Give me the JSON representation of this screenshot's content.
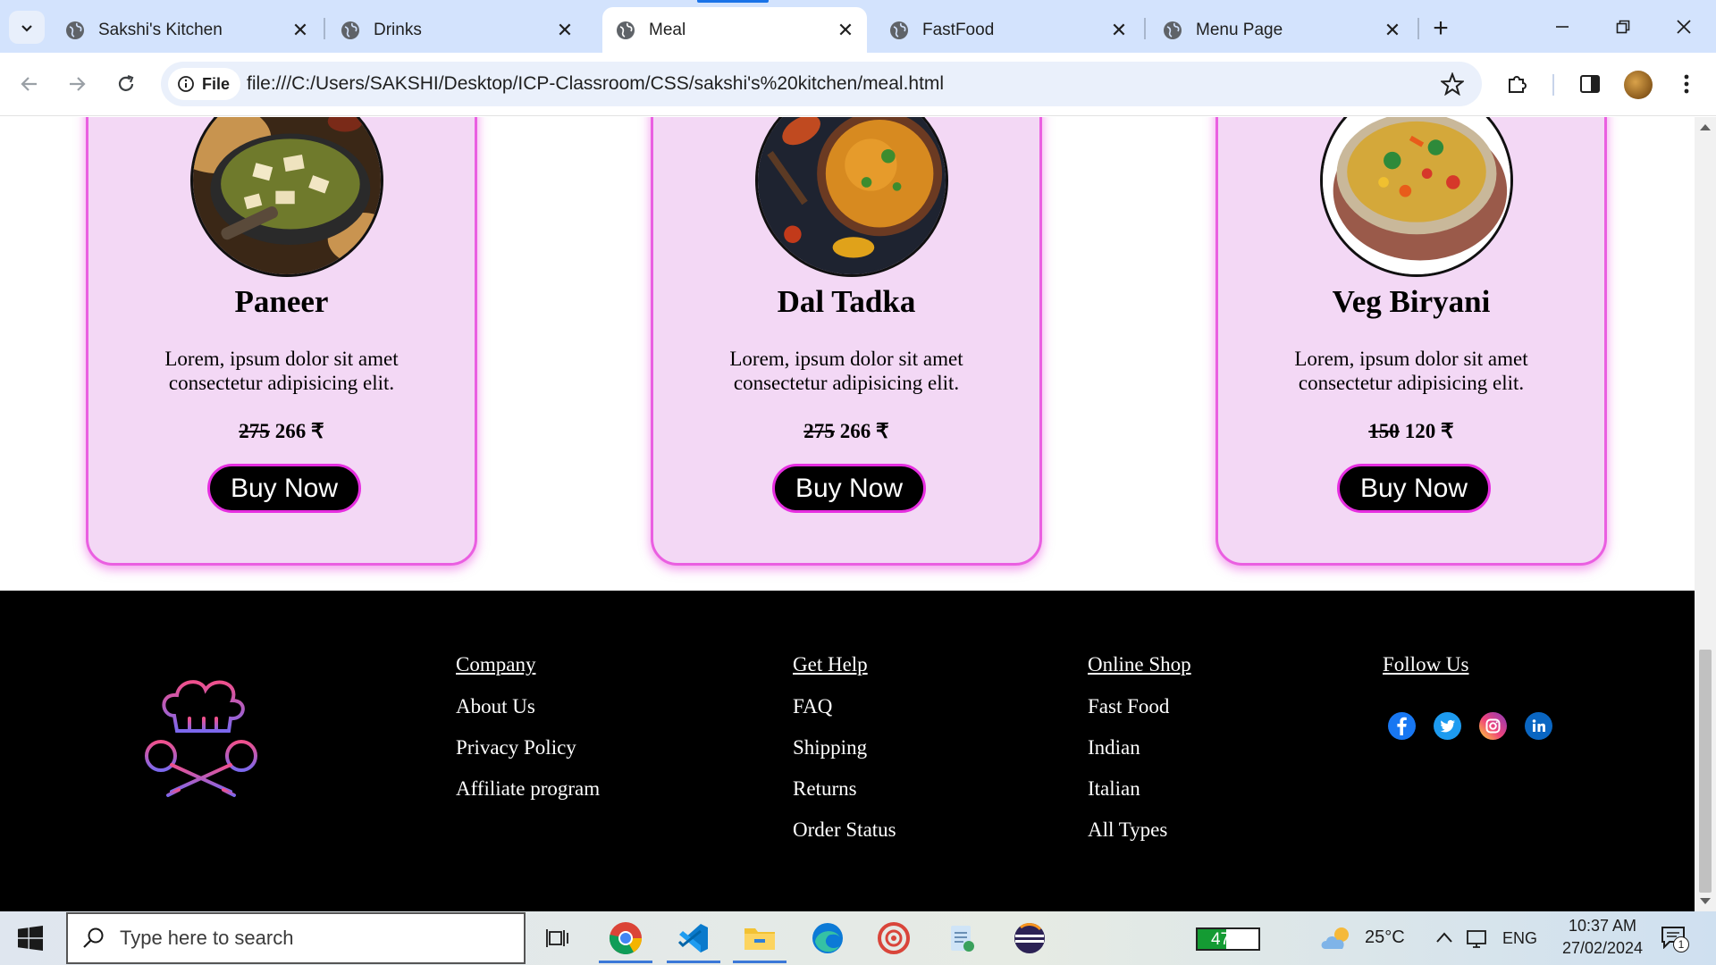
{
  "browser": {
    "tabs": [
      {
        "title": "Sakshi's Kitchen",
        "active": false
      },
      {
        "title": "Drinks",
        "active": false
      },
      {
        "title": "Meal",
        "active": true
      },
      {
        "title": "FastFood",
        "active": false
      },
      {
        "title": "Menu Page",
        "active": false
      }
    ],
    "site_chip": "File",
    "url": "file:///C:/Users/SAKSHI/Desktop/ICP-Classroom/CSS/sakshi's%20kitchen/meal.html"
  },
  "cards": [
    {
      "title": "Paneer",
      "desc": "Lorem, ipsum dolor sit amet consectetur adipisicing elit.",
      "old_price": "275",
      "new_price": "266 ₹",
      "button": "Buy Now",
      "image": "paneer-dish"
    },
    {
      "title": "Dal Tadka",
      "desc": "Lorem, ipsum dolor sit amet consectetur adipisicing elit.",
      "old_price": "275",
      "new_price": "266 ₹",
      "button": "Buy Now",
      "image": "dal-tadka-dish"
    },
    {
      "title": "Veg Biryani",
      "desc": "Lorem, ipsum dolor sit amet consectetur adipisicing elit.",
      "old_price": "150",
      "new_price": "120 ₹",
      "button": "Buy Now",
      "image": "veg-biryani-dish"
    }
  ],
  "footer": {
    "logo": "chef-hat-spoons-icon",
    "columns": [
      {
        "heading": "Company",
        "links": [
          "About Us",
          "Privacy Policy",
          "Affiliate program"
        ]
      },
      {
        "heading": "Get Help",
        "links": [
          "FAQ",
          "Shipping",
          "Returns",
          "Order Status"
        ]
      },
      {
        "heading": "Online Shop",
        "links": [
          "Fast Food",
          "Indian",
          "Italian",
          "All Types"
        ]
      },
      {
        "heading": "Follow Us",
        "links": []
      }
    ],
    "social": [
      "facebook-icon",
      "twitter-icon",
      "instagram-icon",
      "linkedin-icon"
    ]
  },
  "taskbar": {
    "search_placeholder": "Type here to search",
    "battery": "47%",
    "battery_level": 0.47,
    "weather": "25°C",
    "language": "ENG",
    "time": "10:37 AM",
    "date": "27/02/2024",
    "notifications": "1"
  },
  "colors": {
    "card_bg": "#f3d8f5",
    "card_border": "#ea5fe1",
    "button_border": "#e62ee0",
    "footer_bg": "#000000",
    "tabbar_bg": "#d3e3fd"
  }
}
